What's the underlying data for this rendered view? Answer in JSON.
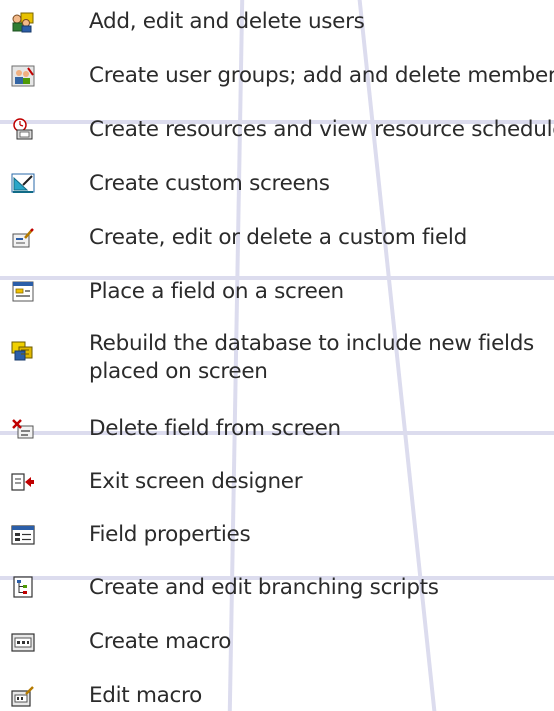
{
  "legend": {
    "items": [
      {
        "icon": "users-icon",
        "label": "Add, edit and delete users"
      },
      {
        "icon": "user-groups-icon",
        "label": "Create user groups; add and delete members"
      },
      {
        "icon": "resources-schedule-icon",
        "label": "Create resources and view resource schedules"
      },
      {
        "icon": "custom-screens-icon",
        "label": "Create custom screens"
      },
      {
        "icon": "custom-field-icon",
        "label": "Create, edit or delete a custom field"
      },
      {
        "icon": "place-field-icon",
        "label": "Place a field on a screen"
      },
      {
        "icon": "rebuild-database-icon",
        "label": "Rebuild the database to include new fields placed on screen"
      },
      {
        "icon": "delete-field-icon",
        "label": "Delete field from screen"
      },
      {
        "icon": "exit-designer-icon",
        "label": "Exit screen designer"
      },
      {
        "icon": "field-properties-icon",
        "label": "Field properties"
      },
      {
        "icon": "branching-scripts-icon",
        "label": "Create and edit branching scripts"
      },
      {
        "icon": "create-macro-icon",
        "label": "Create macro"
      },
      {
        "icon": "edit-macro-icon",
        "label": "Edit macro"
      }
    ]
  }
}
